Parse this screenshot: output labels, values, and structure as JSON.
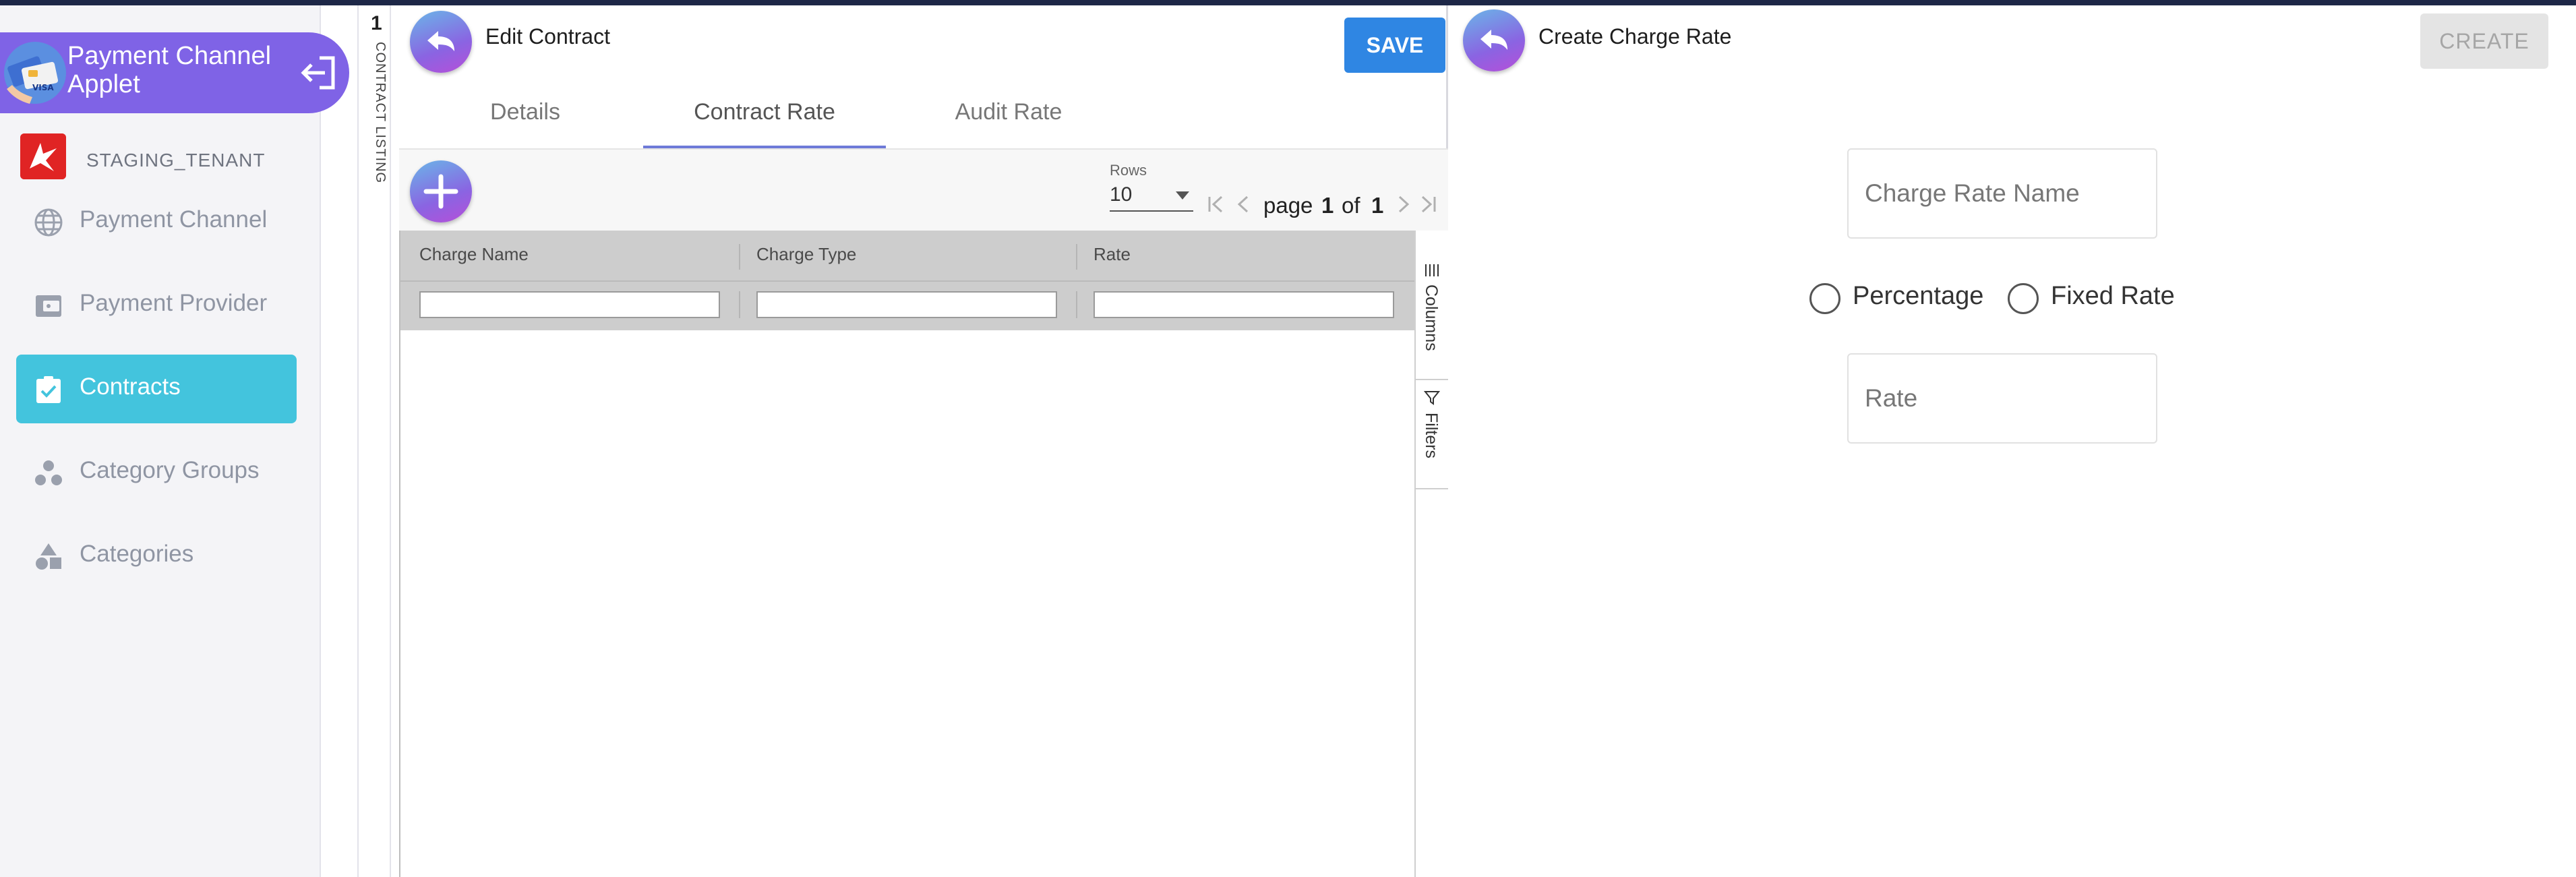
{
  "sidebar": {
    "app_title": "Payment Channel Applet",
    "tenant": "STAGING_TENANT",
    "items": [
      {
        "label": "Payment Channel",
        "icon": "globe-icon"
      },
      {
        "label": "Payment Provider",
        "icon": "wallet-icon"
      },
      {
        "label": "Contracts",
        "icon": "clipboard-check-icon",
        "active": true
      },
      {
        "label": "Category Groups",
        "icon": "circles-group-icon"
      },
      {
        "label": "Categories",
        "icon": "shapes-icon"
      }
    ]
  },
  "listing_strip": {
    "count": "1",
    "label": "CONTRACT LISTING"
  },
  "edit_contract": {
    "title": "Edit Contract",
    "save_label": "SAVE",
    "tabs": [
      {
        "label": "Details"
      },
      {
        "label": "Contract Rate",
        "active": true
      },
      {
        "label": "Audit Rate"
      }
    ],
    "rows_label": "Rows",
    "rows_value": "10",
    "pager": {
      "page_word": "page",
      "current": "1",
      "of_word": "of",
      "total": "1"
    },
    "columns": [
      "Charge Name",
      "Charge Type",
      "Rate"
    ],
    "side_tools": [
      "Columns",
      "Filters"
    ]
  },
  "create_charge_rate": {
    "title": "Create Charge Rate",
    "create_label": "CREATE",
    "charge_rate_name_placeholder": "Charge Rate Name",
    "radio_options": [
      "Percentage",
      "Fixed Rate"
    ],
    "rate_placeholder": "Rate"
  },
  "colors": {
    "accent_purple": "#7f63e6",
    "active_nav": "#43c4dd",
    "save_blue": "#2f86e3"
  }
}
